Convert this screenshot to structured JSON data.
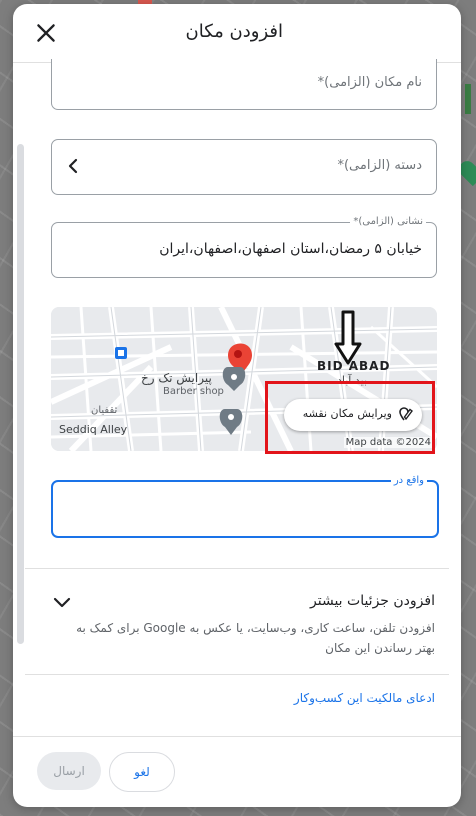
{
  "dialog": {
    "title": "افزودن مکان",
    "close_icon": "close-icon"
  },
  "form": {
    "place_name": {
      "placeholder": "نام مکان (الزامی)*",
      "value": ""
    },
    "category": {
      "placeholder": "دسته (الزامی)*",
      "icon": "chevron-left-icon"
    },
    "address": {
      "label": "نشانی (الزامی)*",
      "value": "خیابان ۵ رمضان،استان اصفهان،اصفهان،ایران"
    },
    "located_in": {
      "label": "واقع در",
      "value": ""
    }
  },
  "map": {
    "area_label": "BID ABAD",
    "area_label_fa": "بید آباد",
    "poi_name": "پیرایش تک رخ",
    "poi_type": "Barber shop",
    "street_label": "Seddiq Alley",
    "street_label_fa": "ثقفیان",
    "edit_button": "ویرایش مکان نقشه",
    "attribution": "Map data ©2024"
  },
  "more_details": {
    "title": "افزودن جزئیات بیشتر",
    "description": "افزودن تلفن، ساعت کاری، وب‌سایت، یا عکس به Google برای کمک به بهتر رساندن این مکان"
  },
  "claim_link": "ادعای مالکیت این کسب‌وکار",
  "actions": {
    "cancel": "لغو",
    "send": "ارسال"
  },
  "colors": {
    "accent": "#1a73e8",
    "annotation_red": "#e2141a",
    "map_pin": "#ea4335"
  }
}
